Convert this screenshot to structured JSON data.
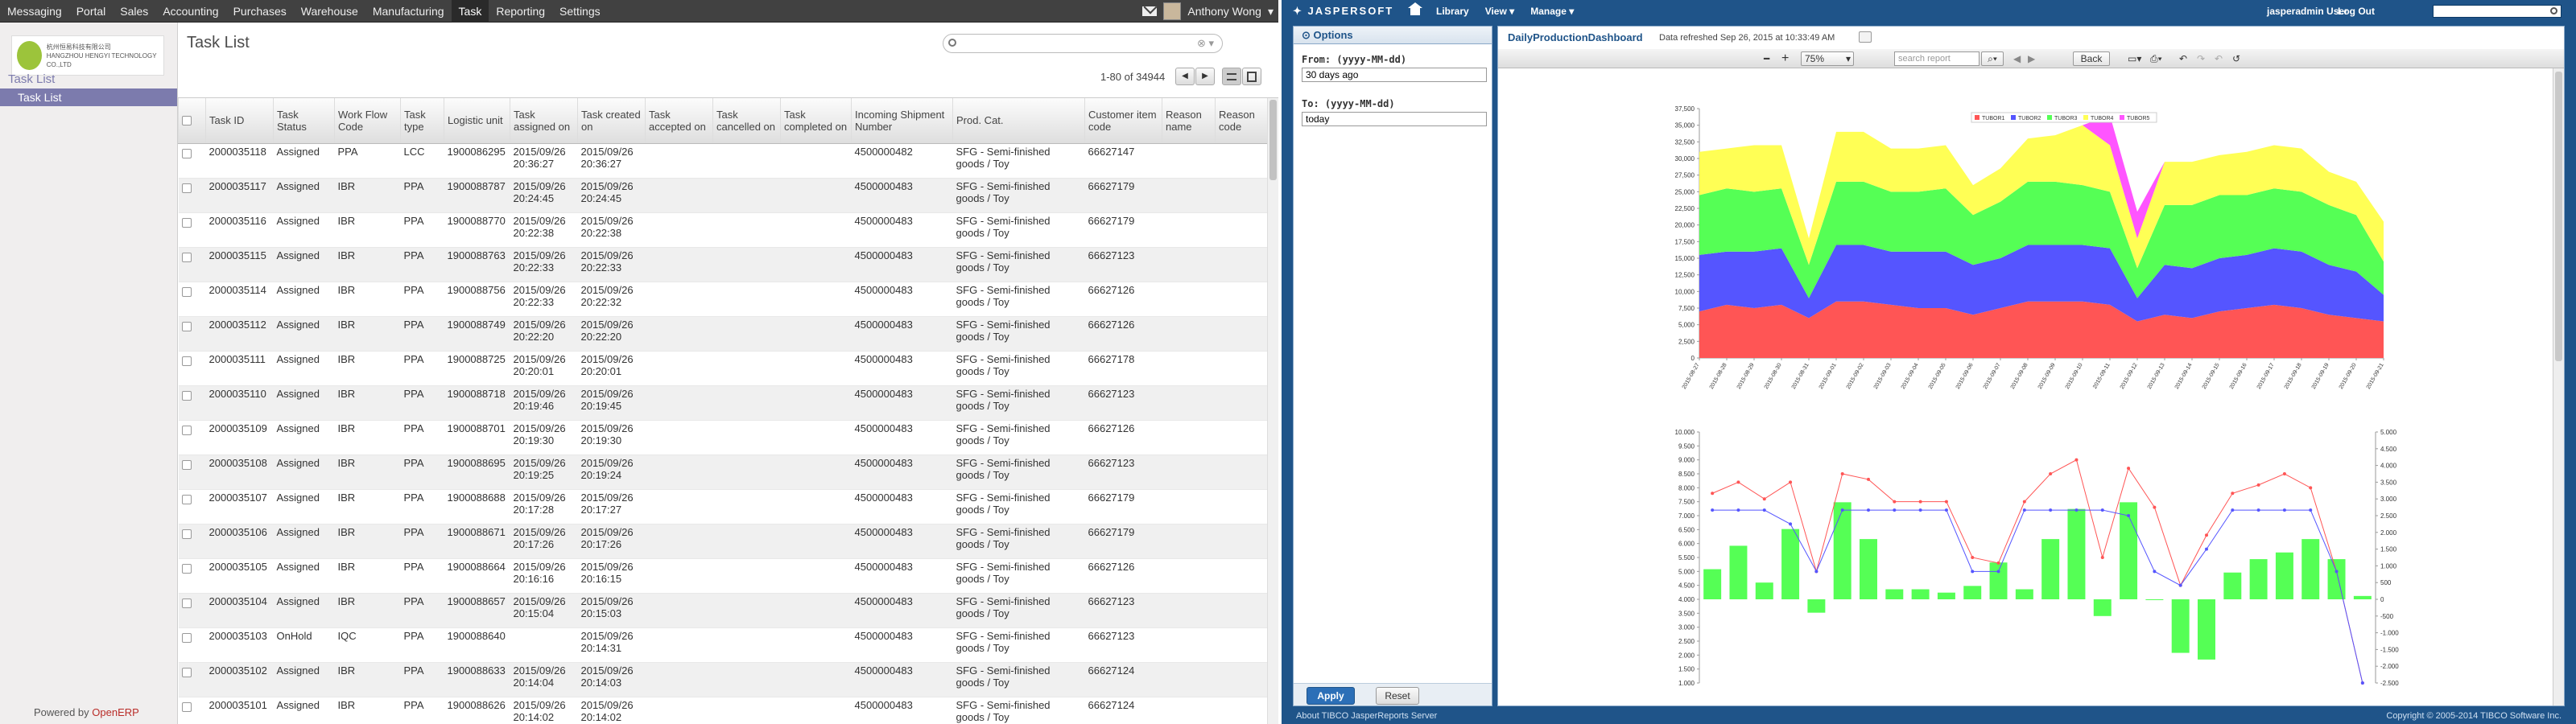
{
  "erp": {
    "topbar": {
      "menu": [
        "Messaging",
        "Portal",
        "Sales",
        "Accounting",
        "Purchases",
        "Warehouse",
        "Manufacturing",
        "Task",
        "Reporting",
        "Settings"
      ],
      "active": "Task",
      "user": "Anthony Wong"
    },
    "sidebar": {
      "section": "Task List",
      "item": "Task List",
      "logo_text_1": "杭州恒易科技有限公司",
      "logo_text_2": "HANGZHOU HENGYI TECHNOLOGY CO.,LTD",
      "powered_by": "Powered by",
      "powered_brand": "OpenERP"
    },
    "header": {
      "title": "Task List",
      "pager": "1-80 of 34944"
    },
    "table": {
      "columns": [
        "Task ID",
        "Task Status",
        "Work Flow Code",
        "Task type",
        "Logistic unit",
        "Task assigned on",
        "Task created on",
        "Task accepted on",
        "Task cancelled on",
        "Task completed on",
        "Incoming Shipment Number",
        "Prod. Cat.",
        "Customer item code",
        "Reason name",
        "Reason code"
      ],
      "rows": [
        [
          "2000035118",
          "Assigned",
          "PPA",
          "LCC",
          "1900086295",
          "2015/09/26 20:36:27",
          "2015/09/26 20:36:27",
          "",
          "",
          "",
          "4500000482",
          "SFG - Semi-finished goods / Toy",
          "66627147",
          "",
          ""
        ],
        [
          "2000035117",
          "Assigned",
          "IBR",
          "PPA",
          "1900088787",
          "2015/09/26 20:24:45",
          "2015/09/26 20:24:45",
          "",
          "",
          "",
          "4500000483",
          "SFG - Semi-finished goods / Toy",
          "66627179",
          "",
          ""
        ],
        [
          "2000035116",
          "Assigned",
          "IBR",
          "PPA",
          "1900088770",
          "2015/09/26 20:22:38",
          "2015/09/26 20:22:38",
          "",
          "",
          "",
          "4500000483",
          "SFG - Semi-finished goods / Toy",
          "66627179",
          "",
          ""
        ],
        [
          "2000035115",
          "Assigned",
          "IBR",
          "PPA",
          "1900088763",
          "2015/09/26 20:22:33",
          "2015/09/26 20:22:33",
          "",
          "",
          "",
          "4500000483",
          "SFG - Semi-finished goods / Toy",
          "66627123",
          "",
          ""
        ],
        [
          "2000035114",
          "Assigned",
          "IBR",
          "PPA",
          "1900088756",
          "2015/09/26 20:22:33",
          "2015/09/26 20:22:32",
          "",
          "",
          "",
          "4500000483",
          "SFG - Semi-finished goods / Toy",
          "66627126",
          "",
          ""
        ],
        [
          "2000035112",
          "Assigned",
          "IBR",
          "PPA",
          "1900088749",
          "2015/09/26 20:22:20",
          "2015/09/26 20:22:20",
          "",
          "",
          "",
          "4500000483",
          "SFG - Semi-finished goods / Toy",
          "66627126",
          "",
          ""
        ],
        [
          "2000035111",
          "Assigned",
          "IBR",
          "PPA",
          "1900088725",
          "2015/09/26 20:20:01",
          "2015/09/26 20:20:01",
          "",
          "",
          "",
          "4500000483",
          "SFG - Semi-finished goods / Toy",
          "66627178",
          "",
          ""
        ],
        [
          "2000035110",
          "Assigned",
          "IBR",
          "PPA",
          "1900088718",
          "2015/09/26 20:19:46",
          "2015/09/26 20:19:45",
          "",
          "",
          "",
          "4500000483",
          "SFG - Semi-finished goods / Toy",
          "66627123",
          "",
          ""
        ],
        [
          "2000035109",
          "Assigned",
          "IBR",
          "PPA",
          "1900088701",
          "2015/09/26 20:19:30",
          "2015/09/26 20:19:30",
          "",
          "",
          "",
          "4500000483",
          "SFG - Semi-finished goods / Toy",
          "66627126",
          "",
          ""
        ],
        [
          "2000035108",
          "Assigned",
          "IBR",
          "PPA",
          "1900088695",
          "2015/09/26 20:19:25",
          "2015/09/26 20:19:24",
          "",
          "",
          "",
          "4500000483",
          "SFG - Semi-finished goods / Toy",
          "66627123",
          "",
          ""
        ],
        [
          "2000035107",
          "Assigned",
          "IBR",
          "PPA",
          "1900088688",
          "2015/09/26 20:17:28",
          "2015/09/26 20:17:27",
          "",
          "",
          "",
          "4500000483",
          "SFG - Semi-finished goods / Toy",
          "66627179",
          "",
          ""
        ],
        [
          "2000035106",
          "Assigned",
          "IBR",
          "PPA",
          "1900088671",
          "2015/09/26 20:17:26",
          "2015/09/26 20:17:26",
          "",
          "",
          "",
          "4500000483",
          "SFG - Semi-finished goods / Toy",
          "66627179",
          "",
          ""
        ],
        [
          "2000035105",
          "Assigned",
          "IBR",
          "PPA",
          "1900088664",
          "2015/09/26 20:16:16",
          "2015/09/26 20:16:15",
          "",
          "",
          "",
          "4500000483",
          "SFG - Semi-finished goods / Toy",
          "66627126",
          "",
          ""
        ],
        [
          "2000035104",
          "Assigned",
          "IBR",
          "PPA",
          "1900088657",
          "2015/09/26 20:15:04",
          "2015/09/26 20:15:03",
          "",
          "",
          "",
          "4500000483",
          "SFG - Semi-finished goods / Toy",
          "66627123",
          "",
          ""
        ],
        [
          "2000035103",
          "OnHold",
          "IQC",
          "PPA",
          "1900088640",
          "",
          "2015/09/26 20:14:31",
          "",
          "",
          "",
          "4500000483",
          "SFG - Semi-finished goods / Toy",
          "66627123",
          "",
          ""
        ],
        [
          "2000035102",
          "Assigned",
          "IBR",
          "PPA",
          "1900088633",
          "2015/09/26 20:14:04",
          "2015/09/26 20:14:03",
          "",
          "",
          "",
          "4500000483",
          "SFG - Semi-finished goods / Toy",
          "66627124",
          "",
          ""
        ],
        [
          "2000035101",
          "Assigned",
          "IBR",
          "PPA",
          "1900088626",
          "2015/09/26 20:14:02",
          "2015/09/26 20:14:02",
          "",
          "",
          "",
          "4500000483",
          "SFG - Semi-finished goods / Toy",
          "66627124",
          "",
          ""
        ]
      ]
    }
  },
  "jasper": {
    "brand": "JASPERSOFT",
    "nav": [
      "Library",
      "View",
      "Manage"
    ],
    "user": "jasperadmin User",
    "logout": "Log Out",
    "options": {
      "title": "Options",
      "from_label": "From: (yyyy-MM-dd)",
      "from_value": "30 days ago",
      "to_label": "To: (yyyy-MM-dd)",
      "to_value": "today",
      "apply": "Apply",
      "reset": "Reset"
    },
    "report": {
      "title": "DailyProductionDashboard",
      "refreshed": "Data refreshed Sep 26, 2015 at 10:33:49 AM",
      "zoom": "75%",
      "search_placeholder": "search report",
      "back": "Back"
    },
    "footer_left": "About TIBCO JasperReports Server",
    "footer_right": "Copyright © 2005-2014 TIBCO Software Inc."
  },
  "colors": {
    "erp_topbar": "#414141",
    "erp_accent": "#7c7bad",
    "jasper_blue": "#1f5489",
    "s1": "#ff5555",
    "s2": "#5555ff",
    "s3": "#55ff55",
    "s4": "#ffff55",
    "s5": "#ff55ff"
  },
  "chart_data": [
    {
      "type": "area",
      "stacked": true,
      "legend_position": "top",
      "categories": [
        "2015-08-27",
        "2015-08-28",
        "2015-08-29",
        "2015-08-30",
        "2015-08-31",
        "2015-09-01",
        "2015-09-02",
        "2015-09-03",
        "2015-09-04",
        "2015-09-05",
        "2015-09-06",
        "2015-09-07",
        "2015-09-08",
        "2015-09-09",
        "2015-09-10",
        "2015-09-11",
        "2015-09-12",
        "2015-09-13",
        "2015-09-14",
        "2015-09-15",
        "2015-09-16",
        "2015-09-17",
        "2015-09-18",
        "2015-09-19",
        "2015-09-20",
        "2015-09-21"
      ],
      "ylim": [
        0,
        37500
      ],
      "yticks": [
        "0",
        "2,500",
        "5,000",
        "7,500",
        "10,000",
        "12,500",
        "15,000",
        "17,500",
        "20,000",
        "22,500",
        "25,000",
        "27,500",
        "30,000",
        "32,500",
        "35,000",
        "37,500"
      ],
      "series": [
        {
          "name": "TUBOR1",
          "values": [
            7000,
            8000,
            7500,
            8000,
            6000,
            8500,
            8500,
            8000,
            7500,
            7500,
            6500,
            7500,
            8500,
            8500,
            8500,
            8000,
            5500,
            6500,
            6000,
            7000,
            7500,
            8000,
            7500,
            6500,
            6000,
            5500
          ]
        },
        {
          "name": "TUBOR2",
          "values": [
            8500,
            8000,
            8500,
            8500,
            3000,
            8500,
            8500,
            8000,
            8500,
            8500,
            7500,
            7500,
            8500,
            8500,
            8500,
            8500,
            3500,
            7500,
            7500,
            8000,
            8000,
            8500,
            8500,
            7500,
            7000,
            4000
          ]
        },
        {
          "name": "TUBOR3",
          "values": [
            9000,
            9500,
            9000,
            9000,
            5000,
            9500,
            9500,
            9000,
            9000,
            9500,
            7500,
            8500,
            9500,
            9500,
            9000,
            8500,
            4500,
            9000,
            9500,
            9500,
            9000,
            9000,
            9000,
            9000,
            8500,
            5000
          ]
        },
        {
          "name": "TUBOR4",
          "values": [
            6500,
            6000,
            7000,
            6500,
            4000,
            7500,
            7500,
            6500,
            6500,
            6500,
            4500,
            5000,
            6500,
            7000,
            9000,
            7000,
            4500,
            6500,
            6500,
            6000,
            6500,
            6500,
            6500,
            5000,
            5000,
            6000
          ]
        },
        {
          "name": "TUBOR5",
          "values": [
            0,
            0,
            0,
            0,
            0,
            0,
            0,
            0,
            0,
            0,
            0,
            0,
            0,
            0,
            0,
            4500,
            4000,
            0,
            0,
            0,
            0,
            0,
            0,
            0,
            0,
            0
          ]
        }
      ]
    },
    {
      "type": "bar",
      "categories": [
        "2015-08-27",
        "2015-08-28",
        "2015-08-29",
        "2015-08-30",
        "2015-08-31",
        "2015-09-01",
        "2015-09-02",
        "2015-09-03",
        "2015-09-04",
        "2015-09-05",
        "2015-09-06",
        "2015-09-07",
        "2015-09-08",
        "2015-09-09",
        "2015-09-10",
        "2015-09-11",
        "2015-09-12",
        "2015-09-13",
        "2015-09-14",
        "2015-09-15",
        "2015-09-16",
        "2015-09-17",
        "2015-09-18",
        "2015-09-19",
        "2015-09-20",
        "2015-09-21"
      ],
      "ylim_left": [
        1000,
        10000
      ],
      "yticks_left": [
        "1.000",
        "1.500",
        "2.000",
        "2.500",
        "3.000",
        "3.500",
        "4.000",
        "4.500",
        "5.000",
        "5.500",
        "6.000",
        "6.500",
        "7.000",
        "7.500",
        "8.000",
        "8.500",
        "9.000",
        "9.500",
        "10.000"
      ],
      "ylim_right": [
        -2500,
        5000
      ],
      "yticks_right": [
        "-2.500",
        "-2.000",
        "-1.500",
        "-1.000",
        "-500",
        "0",
        "500",
        "1.000",
        "1.500",
        "2.000",
        "2.500",
        "3.000",
        "3.500",
        "4.000",
        "4.500",
        "5.000"
      ],
      "series": [
        {
          "values": [
            900,
            1600,
            500,
            2100,
            -400,
            2900,
            1800,
            300,
            300,
            200,
            400,
            1100,
            300,
            1800,
            2700,
            -500,
            2900,
            0,
            -1600,
            -1800,
            800,
            1200,
            1400,
            1800,
            1200,
            100
          ]
        },
        {
          "values": [
            7800,
            8200,
            7600,
            8200,
            5000,
            8500,
            8300,
            7500,
            7500,
            7500,
            5500,
            5300,
            7500,
            8500,
            9000,
            5500,
            8700,
            7300,
            4500,
            6300,
            7800,
            8100,
            8500,
            8000,
            5000,
            0
          ]
        },
        {
          "values": [
            7200,
            7200,
            7200,
            6700,
            5000,
            7200,
            7200,
            7200,
            7200,
            7200,
            5000,
            5000,
            7200,
            7200,
            7200,
            7200,
            7000,
            5000,
            4500,
            5800,
            7200,
            7200,
            7200,
            7200,
            5000,
            0
          ]
        }
      ]
    }
  ]
}
